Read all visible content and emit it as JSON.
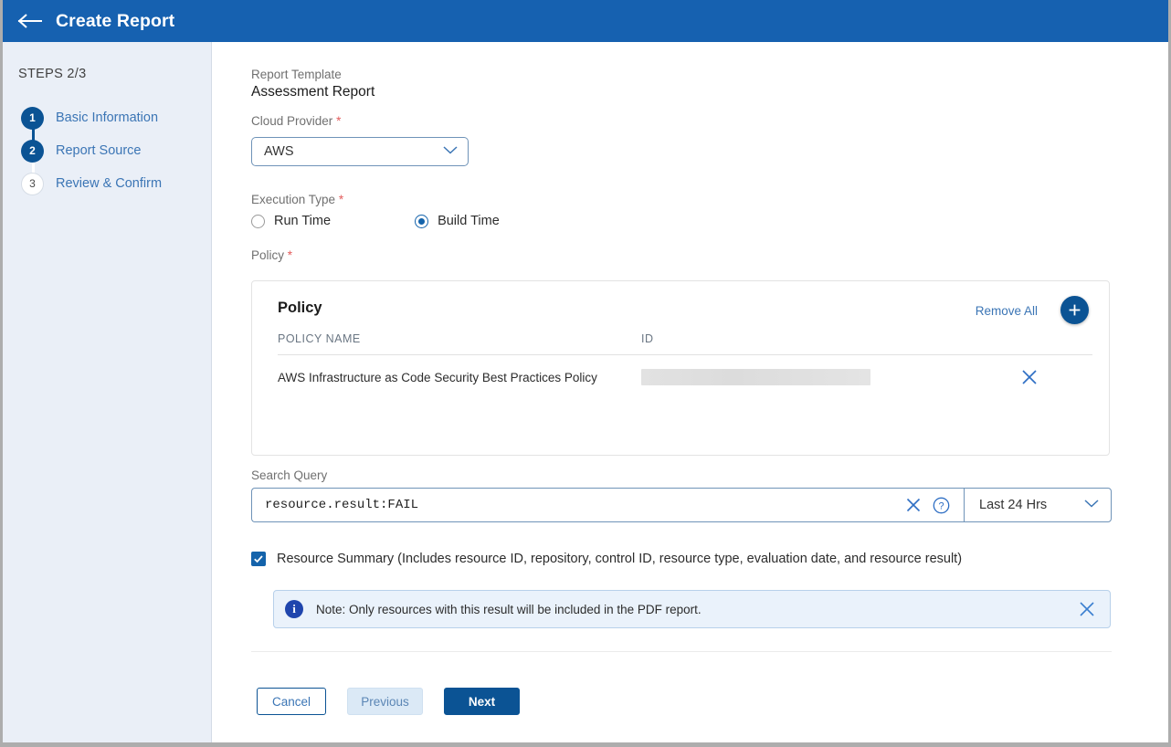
{
  "header": {
    "title": "Create Report",
    "back_icon": "back-arrow-icon"
  },
  "sidebar": {
    "steps_label": "STEPS 2/3",
    "steps": [
      {
        "number": "1",
        "label": "Basic Information",
        "state": "done"
      },
      {
        "number": "2",
        "label": "Report Source",
        "state": "done"
      },
      {
        "number": "3",
        "label": "Review & Confirm",
        "state": "todo"
      }
    ]
  },
  "main": {
    "report_template": {
      "label": "Report Template",
      "value": "Assessment Report"
    },
    "cloud_provider": {
      "label": "Cloud Provider",
      "required": "*",
      "value": "AWS"
    },
    "execution_type": {
      "label": "Execution Type",
      "required": "*",
      "options": [
        {
          "label": "Run Time",
          "selected": false
        },
        {
          "label": "Build Time",
          "selected": true
        }
      ]
    },
    "policy": {
      "label": "Policy",
      "required": "*",
      "panel_title": "Policy",
      "remove_all_label": "Remove All",
      "add_label": "+",
      "columns": [
        "POLICY NAME",
        "ID"
      ],
      "rows": [
        {
          "name": "AWS Infrastructure as Code Security Best Practices Policy",
          "id": ""
        }
      ]
    },
    "search_query": {
      "label": "Search Query",
      "value": "resource.result:FAIL",
      "placeholder": "",
      "time_range": "Last 24 Hrs"
    },
    "resource_summary": {
      "checked": true,
      "label": "Resource Summary (Includes resource ID, repository, control ID, resource type, evaluation date, and resource result)"
    },
    "note": {
      "text": "Note: Only resources with this result will be included in the PDF report."
    },
    "buttons": {
      "cancel": "Cancel",
      "previous": "Previous",
      "next": "Next"
    }
  },
  "colors": {
    "header_blue": "#1661b0",
    "accent_blue": "#0b5394",
    "link_blue": "#3b75b5",
    "sidebar_bg": "#eaeff7",
    "required_red": "#e35c5c",
    "note_bg": "#eaf2fb"
  }
}
